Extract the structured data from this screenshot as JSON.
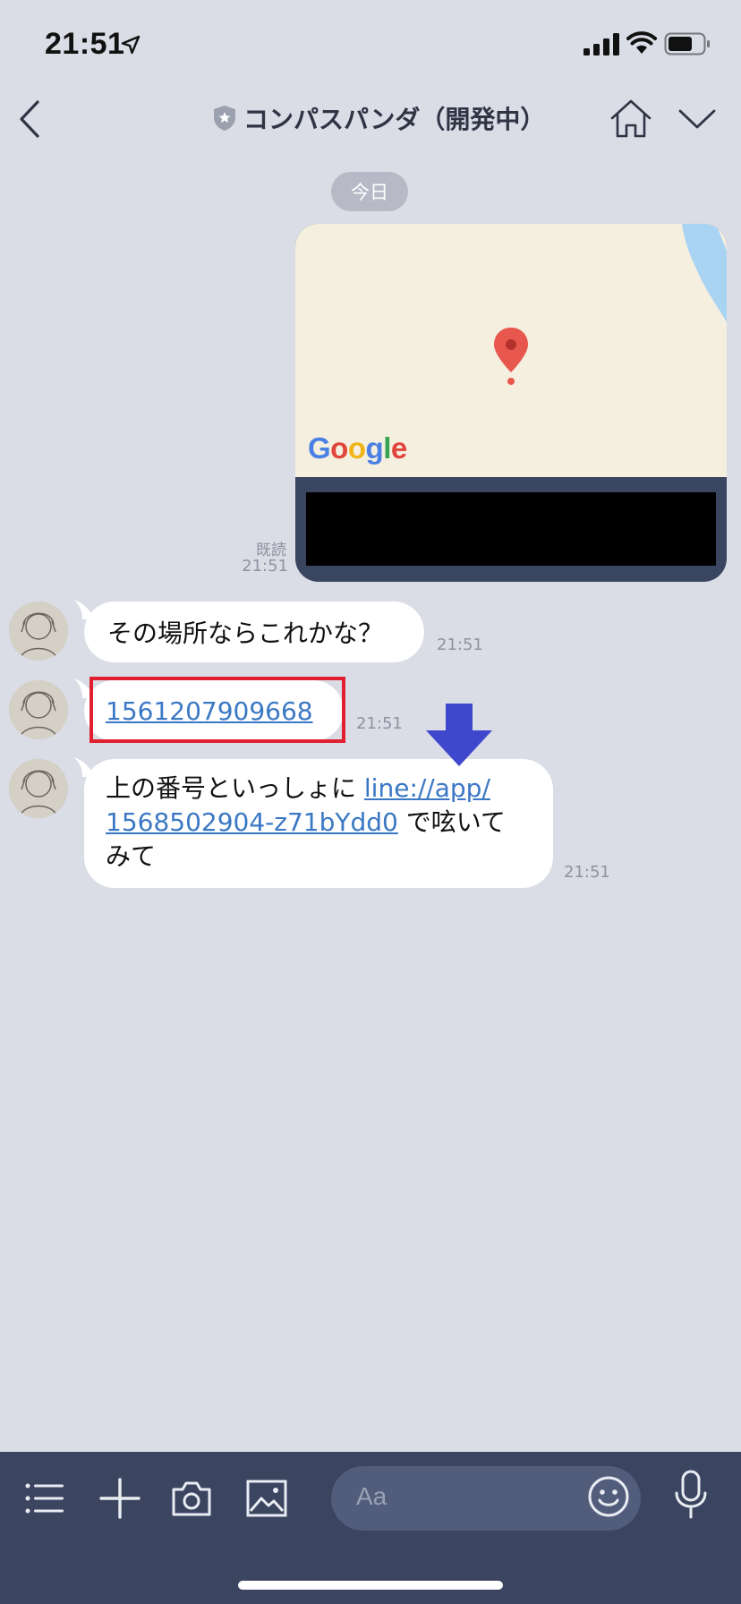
{
  "status_bar": {
    "time": "21:51"
  },
  "header": {
    "title": "コンパスパンダ（開発中）"
  },
  "date_chip": "今日",
  "map_message": {
    "provider_logo": [
      "G",
      "o",
      "o",
      "g",
      "l",
      "e"
    ],
    "read_label": "既読",
    "time": "21:51"
  },
  "messages": [
    {
      "text": "その場所ならこれかな？",
      "time": "21:51"
    },
    {
      "link": "1561207909668",
      "time": "21:51"
    },
    {
      "text_before": "上の番号といっしょに ",
      "link": "line://app/1568502904-z71bYdd0",
      "link_line1": "line://app/",
      "link_line2": "1568502904-z71bYdd0",
      "text_after_line2": " で呟いて",
      "text_line3": "みて",
      "time": "21:51"
    }
  ],
  "input_bar": {
    "placeholder": "Aa"
  },
  "colors": {
    "background": "#dadce6",
    "bubble": "#ffffff",
    "link": "#3b78c4",
    "highlight": "#e0202e",
    "annotation_arrow": "#3f48cc",
    "input_bar": "#3b4560"
  }
}
